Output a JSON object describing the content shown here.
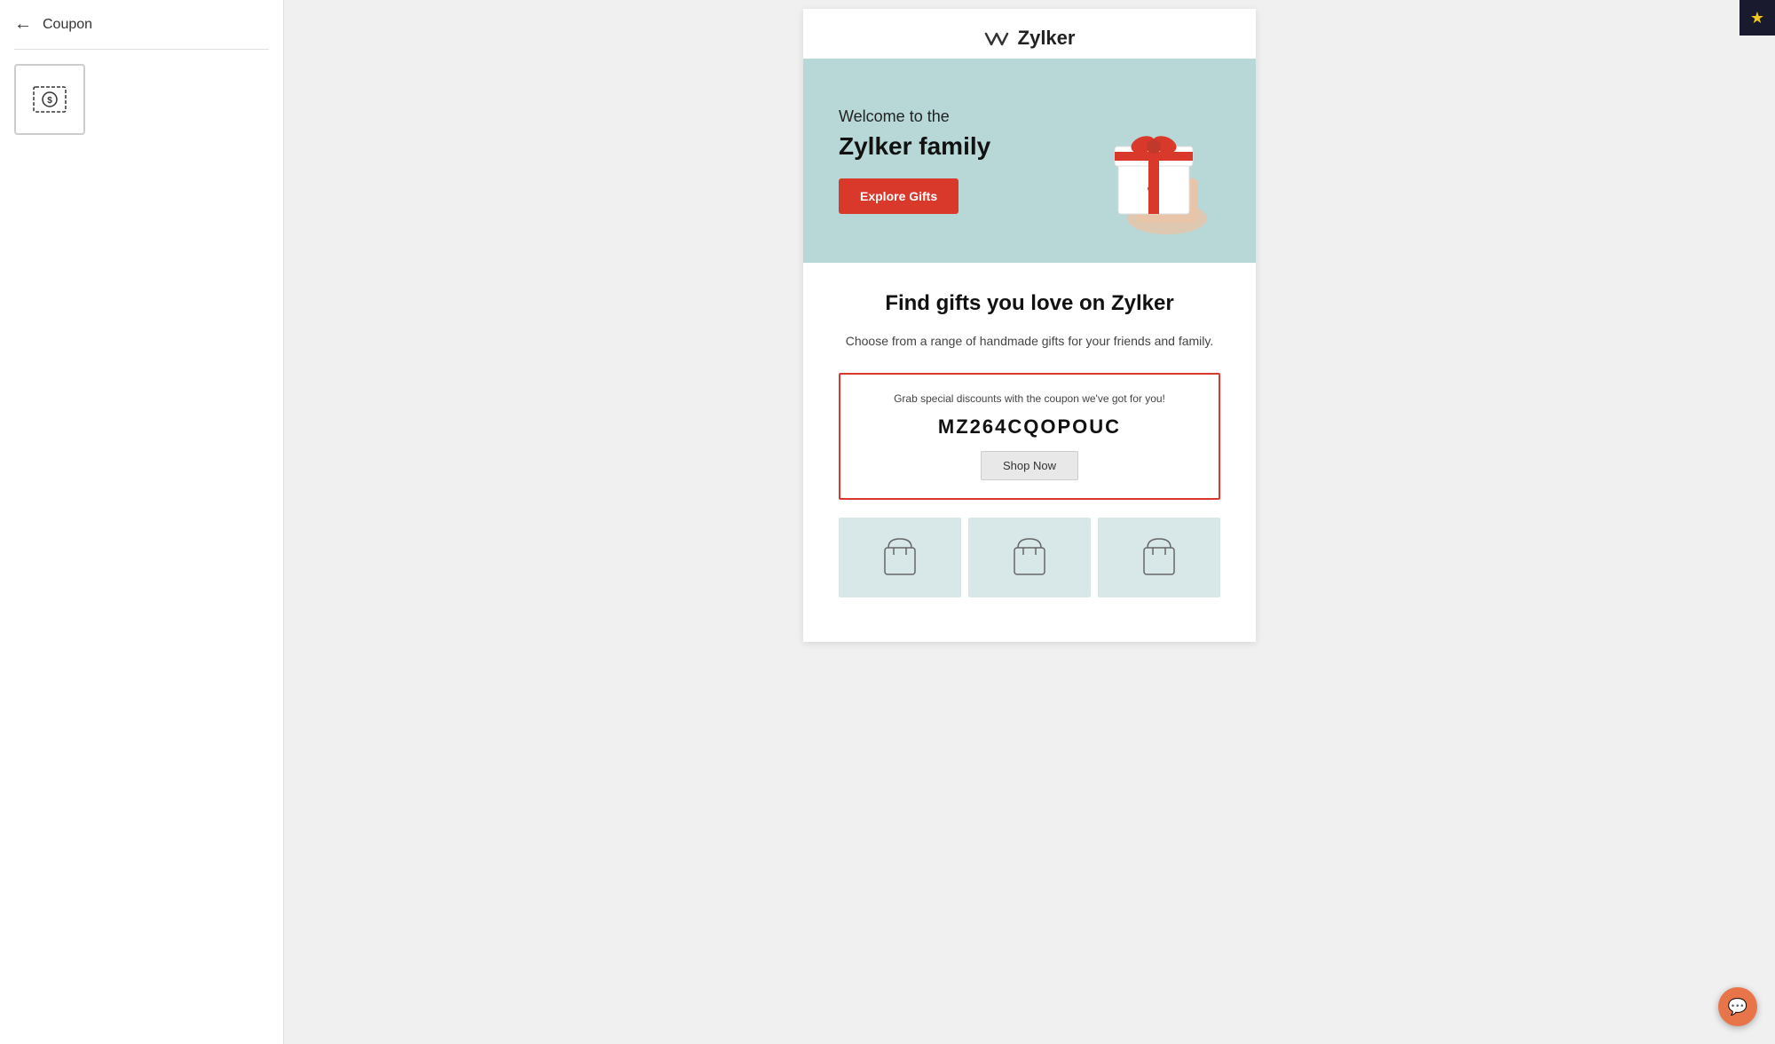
{
  "sidebar": {
    "back_label": "←",
    "title": "Coupon",
    "coupon_template_alt": "Coupon template thumbnail"
  },
  "topbar": {
    "star_button_label": "★"
  },
  "email": {
    "logo": {
      "icon": "M",
      "name": "Zylker"
    },
    "hero": {
      "subtitle": "Welcome to the",
      "title": "Zylker family",
      "cta_button": "Explore Gifts"
    },
    "body": {
      "heading": "Find gifts you love on Zylker",
      "subtext": "Choose from a range of handmade gifts for your friends and family.",
      "coupon": {
        "promo_text": "Grab special discounts with the coupon we've got for you!",
        "code": "MZ264CQOPOUC",
        "shop_now": "Shop Now"
      }
    }
  },
  "colors": {
    "hero_bg": "#b8d8d8",
    "cta_red": "#d9392b",
    "coupon_border": "#d9392b",
    "bag_bg": "#d8e8e8",
    "chat_btn": "#e8754a",
    "star_bg": "#1a1a2e"
  }
}
